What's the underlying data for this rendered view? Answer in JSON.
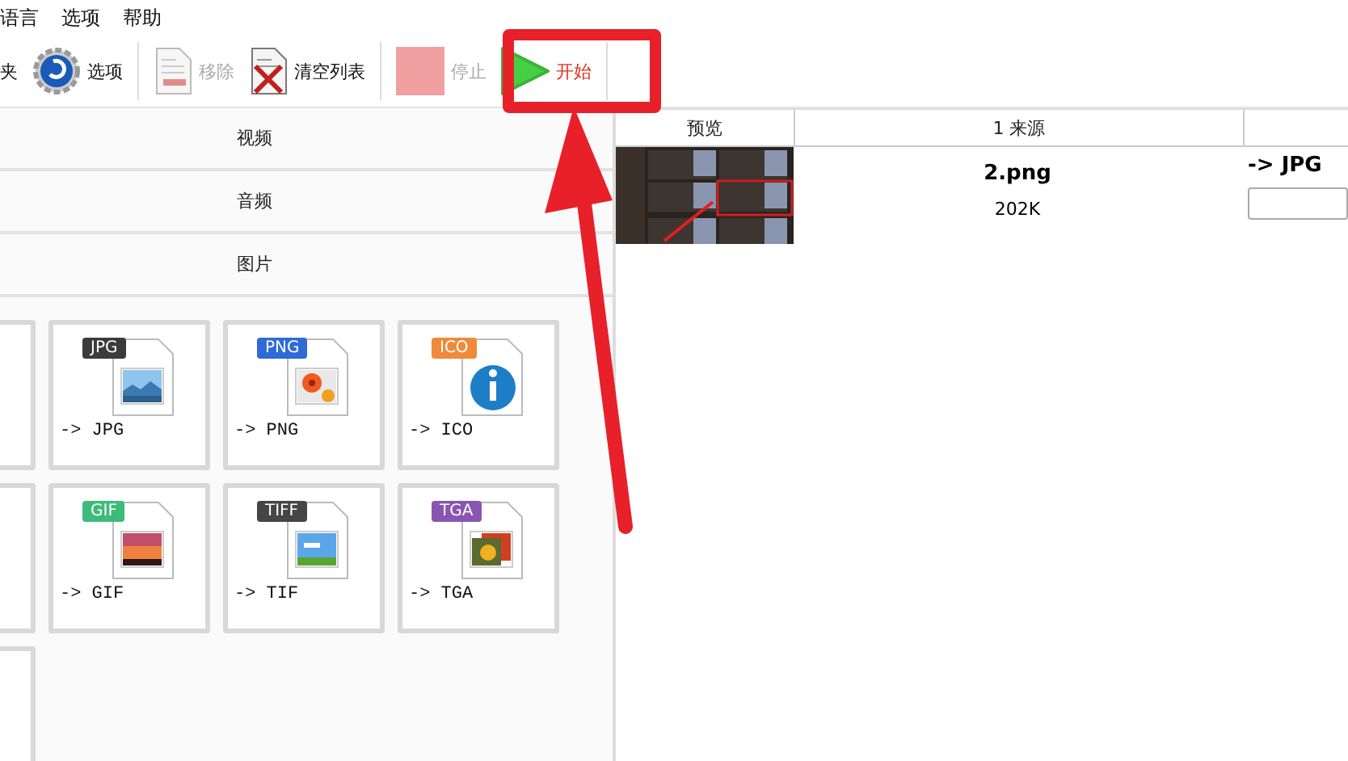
{
  "menu": [
    {
      "label": "语言"
    },
    {
      "label": "选项"
    },
    {
      "label": "帮助"
    }
  ],
  "toolbar": [
    {
      "kind": "text",
      "label": "夹",
      "disabled": false
    },
    {
      "kind": "gear",
      "label": "选项",
      "disabled": false
    },
    {
      "kind": "separator"
    },
    {
      "kind": "document",
      "label": "移除",
      "disabled": true
    },
    {
      "kind": "document-cross",
      "label": "清空列表",
      "disabled": false
    },
    {
      "kind": "separator"
    },
    {
      "kind": "stop",
      "label": "停止",
      "disabled": true
    },
    {
      "kind": "play",
      "label": "开始",
      "disabled": false
    },
    {
      "kind": "separator"
    }
  ],
  "categories": [
    {
      "label": "视频"
    },
    {
      "label": "音频"
    },
    {
      "label": "图片"
    }
  ],
  "tiles": [
    {
      "kind": "empty"
    },
    {
      "kind": "format",
      "badge": "JPG",
      "color": "#3b3b3b",
      "art": {
        "kind": "landscape"
      },
      "label": "-> JPG"
    },
    {
      "kind": "format",
      "badge": "PNG",
      "color": "#2f6ad8",
      "art": {
        "kind": "flower"
      },
      "label": "-> PNG"
    },
    {
      "kind": "format",
      "badge": "ICO",
      "color": "#ee8a3a",
      "art": {
        "kind": "info"
      },
      "label": "-> ICO"
    },
    {
      "kind": "empty"
    },
    {
      "kind": "format",
      "badge": "GIF",
      "color": "#3dbb7a",
      "art": {
        "kind": "sunset"
      },
      "label": "-> GIF"
    },
    {
      "kind": "format",
      "badge": "TIFF",
      "color": "#454545",
      "art": {
        "kind": "meadow"
      },
      "label": "-> TIF"
    },
    {
      "kind": "format",
      "badge": "TGA",
      "color": "#8a55b0",
      "art": {
        "kind": "stack"
      },
      "label": "-> TGA"
    },
    {
      "kind": "empty"
    }
  ],
  "table": {
    "columns": [
      {
        "label": "预览"
      },
      {
        "label": "1 来源"
      }
    ],
    "rows": [
      {
        "name": "2.png",
        "size": "202K",
        "target": "-> JPG"
      }
    ]
  },
  "annotation_box": true,
  "annotation_arrow": true
}
